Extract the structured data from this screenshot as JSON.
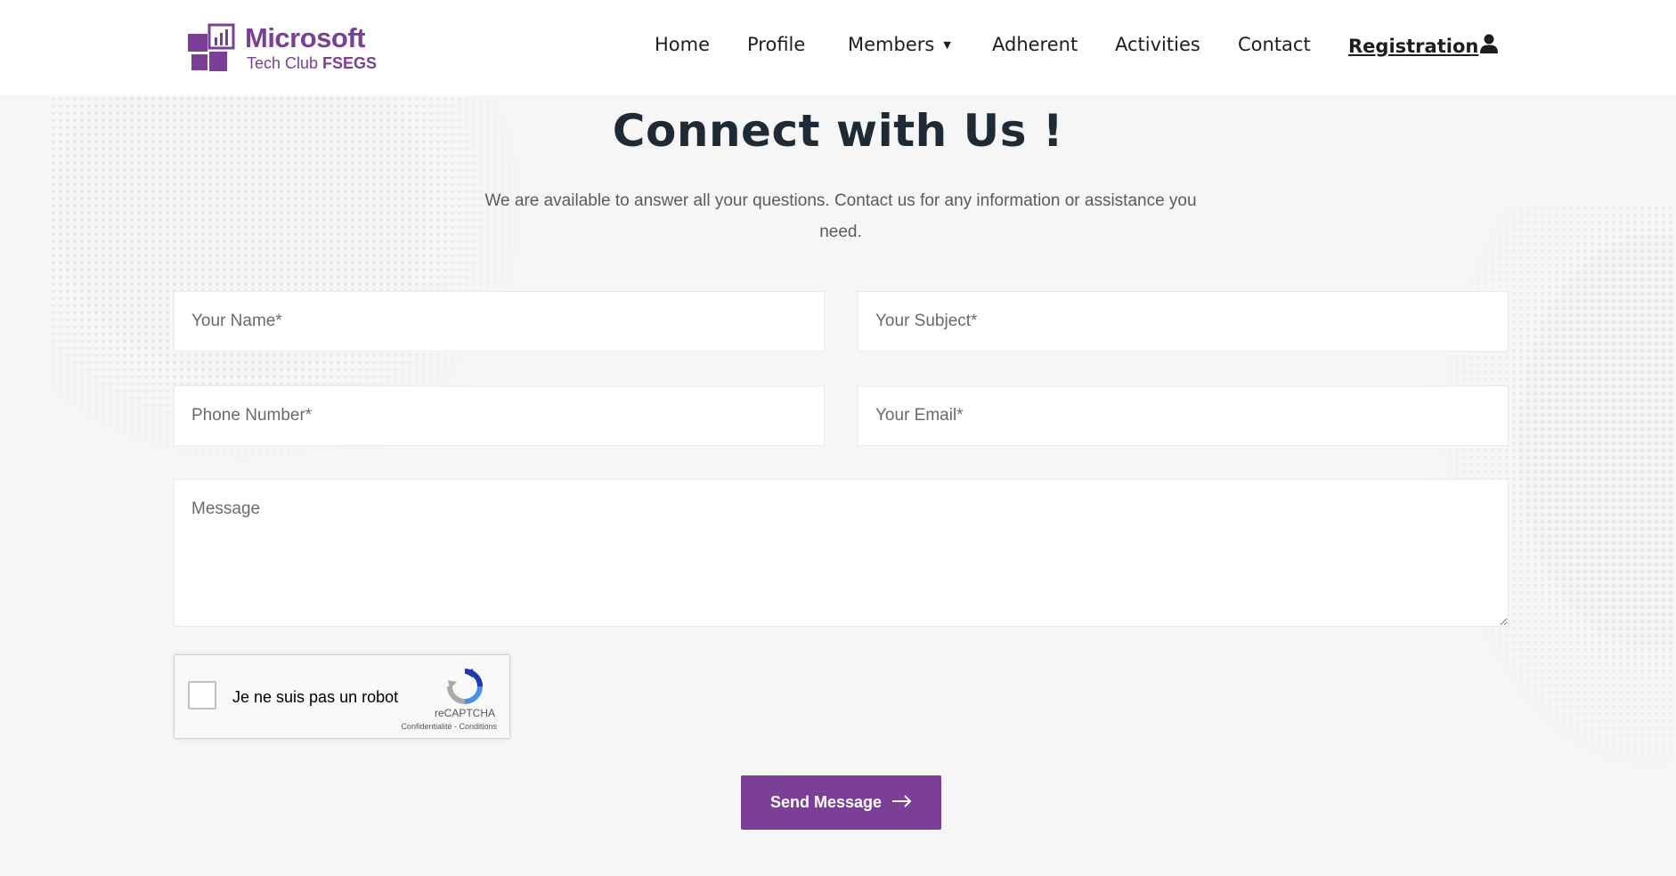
{
  "brand": {
    "title": "Microsoft",
    "subtitle_prefix": "Tech Club ",
    "subtitle_bold": "FSEGS",
    "color": "#7b3f98"
  },
  "nav": {
    "items": [
      {
        "label": "Home"
      },
      {
        "label": "Profile"
      },
      {
        "label": "Members",
        "dropdown": true
      },
      {
        "label": "Adherent"
      },
      {
        "label": "Activities"
      },
      {
        "label": "Contact"
      },
      {
        "label": "Registration",
        "active": true,
        "icon": "user-icon"
      }
    ]
  },
  "hero": {
    "title": "Connect with Us !",
    "subtitle": "We are available to answer all your questions. Contact us for any information or assistance you need."
  },
  "form": {
    "name_placeholder": "Your Name*",
    "subject_placeholder": "Your Subject*",
    "phone_placeholder": "Phone Number*",
    "email_placeholder": "Your Email*",
    "message_placeholder": "Message",
    "recaptcha": {
      "label": "Je ne suis pas un robot",
      "brand": "reCAPTCHA",
      "links": "Confidentialité - Conditions"
    },
    "submit_label": "Send Message"
  }
}
